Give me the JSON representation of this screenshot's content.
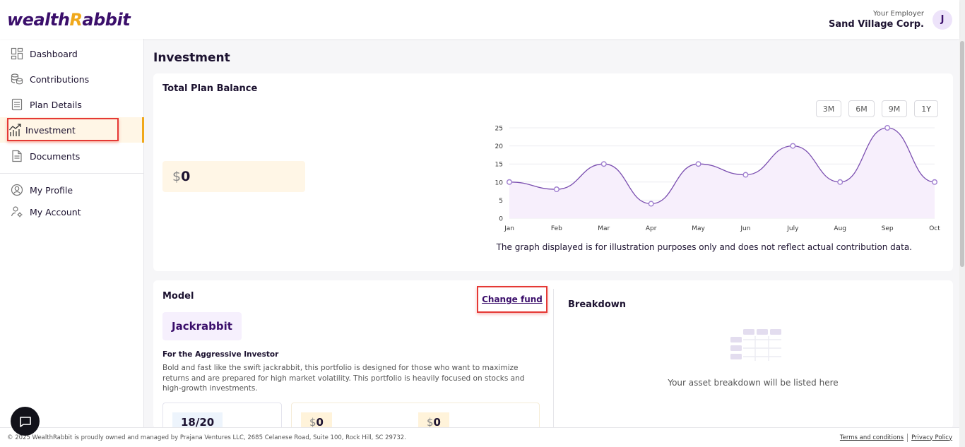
{
  "brand": {
    "part1": "wealth",
    "part2": "R",
    "part3": "abbit"
  },
  "header": {
    "employer_label": "Your Employer",
    "employer_name": "Sand Village Corp.",
    "avatar_initial": "J"
  },
  "sidebar": {
    "items": [
      {
        "label": "Dashboard",
        "icon": "dashboard-icon"
      },
      {
        "label": "Contributions",
        "icon": "coins-icon"
      },
      {
        "label": "Plan Details",
        "icon": "document-list-icon"
      },
      {
        "label": "Investment",
        "icon": "chart-growth-icon",
        "active": true
      },
      {
        "label": "Documents",
        "icon": "file-icon"
      }
    ],
    "account_items": [
      {
        "label": "My Profile",
        "icon": "user-circle-icon"
      },
      {
        "label": "My Account",
        "icon": "user-settings-icon"
      }
    ]
  },
  "page": {
    "title": "Investment"
  },
  "balance": {
    "title": "Total Plan Balance",
    "currency": "$",
    "amount": "0",
    "ranges": [
      "3M",
      "6M",
      "9M",
      "1Y"
    ],
    "note": "The graph displayed is for illustration purposes only and does not reflect actual contribution data."
  },
  "chart_data": {
    "type": "line",
    "categories": [
      "Jan",
      "Feb",
      "Mar",
      "Apr",
      "May",
      "Jun",
      "July",
      "Aug",
      "Sep",
      "Oct"
    ],
    "values": [
      10,
      8,
      15,
      4,
      15,
      12,
      20,
      10,
      25,
      10
    ],
    "yticks": [
      0,
      5,
      10,
      15,
      20,
      25
    ],
    "ylim": [
      0,
      25
    ],
    "grid": true,
    "color": "#7b4fb0",
    "fill": "#f7effc"
  },
  "model": {
    "title": "Model",
    "change_fund": "Change fund",
    "fund_name": "Jackrabbit",
    "investor_type": "For the Aggressive Investor",
    "description": "Bold and fast like the swift jackrabbit, this portfolio is designed for those who want to maximize returns and are prepared for high market volatility. This portfolio is heavily focused on stocks and high-growth investments.",
    "score": "18/20",
    "stat1_cur": "$",
    "stat1_val": "0",
    "stat2_cur": "$",
    "stat2_val": "0"
  },
  "breakdown": {
    "title": "Breakdown",
    "empty_text": "Your asset breakdown will be listed here"
  },
  "footer": {
    "copyright": "© 2025 WealthRabbit is proudly owned and managed by Prajana Ventures LLC, 2685 Celanese Road, Suite 100, Rock Hill, SC 29732.",
    "terms": "Terms and conditions",
    "privacy": "Privacy Policy"
  },
  "colors": {
    "accent": "#3b0f6b",
    "gold": "#f0a81b",
    "highlight": "#e53935"
  }
}
